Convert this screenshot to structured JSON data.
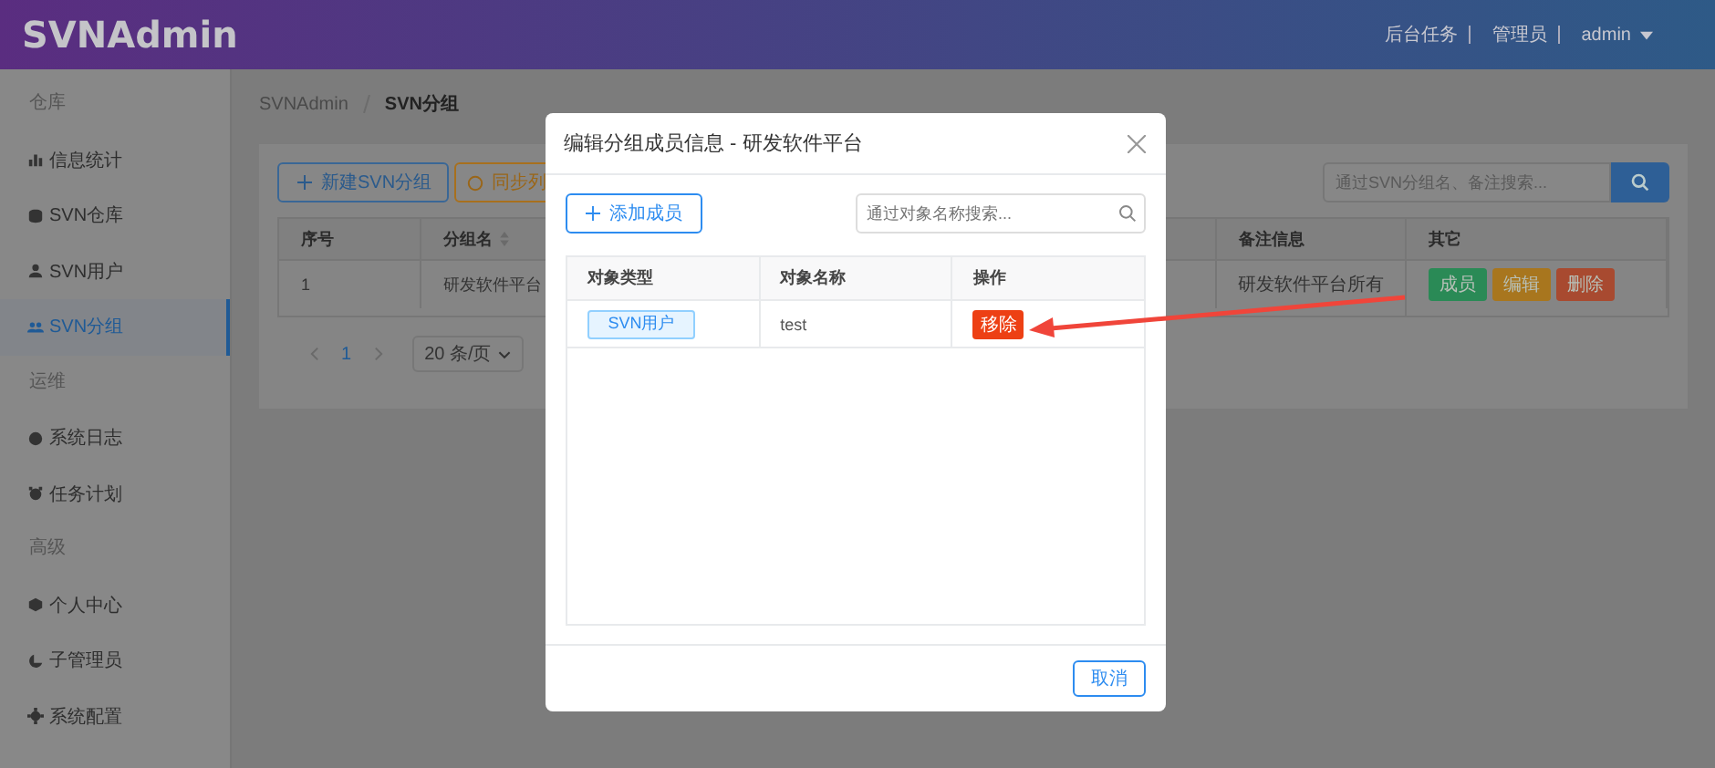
{
  "header": {
    "logo": "SVNAdmin",
    "links": [
      "后台任务",
      "管理员"
    ],
    "user": "admin"
  },
  "sidebar": {
    "items": [
      {
        "kind": "section",
        "label": "仓库",
        "selected": false
      },
      {
        "kind": "item",
        "label": "信息统计",
        "selected": false
      },
      {
        "kind": "item",
        "label": "SVN仓库",
        "selected": false
      },
      {
        "kind": "item",
        "label": "SVN用户",
        "selected": false
      },
      {
        "kind": "item",
        "label": "SVN分组",
        "selected": true
      },
      {
        "kind": "section",
        "label": "运维",
        "selected": false
      },
      {
        "kind": "item",
        "label": "系统日志",
        "selected": false
      },
      {
        "kind": "item",
        "label": "任务计划",
        "selected": false
      },
      {
        "kind": "section",
        "label": "高级",
        "selected": false
      },
      {
        "kind": "item",
        "label": "个人中心",
        "selected": false
      },
      {
        "kind": "item",
        "label": "子管理员",
        "selected": false
      },
      {
        "kind": "item",
        "label": "系统配置",
        "selected": false
      }
    ]
  },
  "breadcrumb": [
    "SVNAdmin",
    "SVN分组"
  ],
  "toolbar": {
    "buttons": [
      {
        "label": "新建SVN分组",
        "kind": "primary"
      },
      {
        "label": "同步列",
        "kind": "warning"
      }
    ],
    "search": {
      "placeholder": "通过SVN分组名、备注搜索..."
    }
  },
  "table": {
    "columns": [
      "序号",
      "分组名",
      "备注信息",
      "其它"
    ],
    "rows": [
      {
        "index": "1",
        "name": "研发软件平台",
        "note": "研发软件平台所有",
        "actions": [
          {
            "label": "成员",
            "color": "#2a8a56"
          },
          {
            "label": "编辑",
            "color": "#a8761e"
          },
          {
            "label": "删除",
            "color": "#a84a30"
          }
        ]
      }
    ]
  },
  "pagination": {
    "pages": [
      {
        "label": "1",
        "selected": true
      }
    ],
    "page_size": "20 条/页"
  },
  "dialog": {
    "title": "编辑分组成员信息 - 研发软件平台",
    "add_button": "添加成员",
    "search": {
      "placeholder": "通过对象名称搜索..."
    },
    "columns": [
      "对象类型",
      "对象名称",
      "操作"
    ],
    "rows": [
      {
        "type": "SVN用户",
        "name": "test",
        "action": "移除"
      }
    ],
    "cancel": "取消"
  }
}
